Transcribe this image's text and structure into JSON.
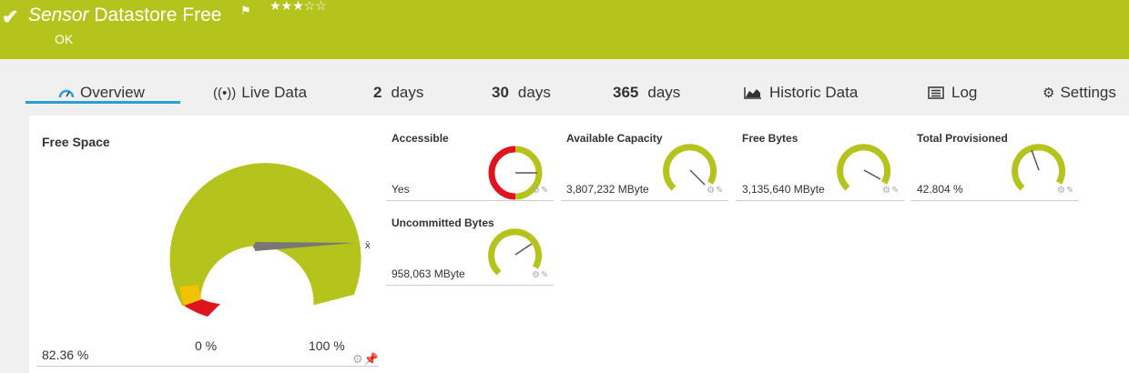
{
  "header": {
    "title_italic": "Sensor",
    "title_rest": " Datastore Free",
    "status": "OK",
    "stars": "★★★☆☆",
    "check_glyph": "✔",
    "flag_glyph": "⚑"
  },
  "tabs": [
    {
      "icon": "gauge-icon",
      "label": "Overview",
      "active": true
    },
    {
      "icon": "live-data-icon",
      "label": "Live Data"
    },
    {
      "num": "2",
      "label": "days"
    },
    {
      "num": "30",
      "label": "days"
    },
    {
      "num": "365",
      "label": "days"
    },
    {
      "icon": "historic-chart-icon",
      "label": "Historic Data"
    },
    {
      "icon": "log-icon",
      "label": "Log"
    },
    {
      "icon": "gear-icon",
      "label": "Settings"
    }
  ],
  "free_space": {
    "title": "Free Space",
    "value": "82.36 %",
    "min_label": "0 %",
    "max_label": "100 %",
    "avg_marker": "x̄",
    "level_pct": 82.36
  },
  "channels": [
    {
      "title": "Accessible",
      "value": "Yes"
    },
    {
      "title": "Available Capacity",
      "value": "3,807,232 MByte"
    },
    {
      "title": "Free Bytes",
      "value": "3,135,640 MByte"
    },
    {
      "title": "Total Provisioned",
      "value": "42.804 %"
    },
    {
      "title": "Uncommitted Bytes",
      "value": "958,063 MByte"
    }
  ],
  "colors": {
    "header": "#b5c41c",
    "gauge_ok": "#b5c41c",
    "gauge_warn": "#f2c200",
    "gauge_error": "#e0141e",
    "tab_active": "#2a9fd6"
  }
}
